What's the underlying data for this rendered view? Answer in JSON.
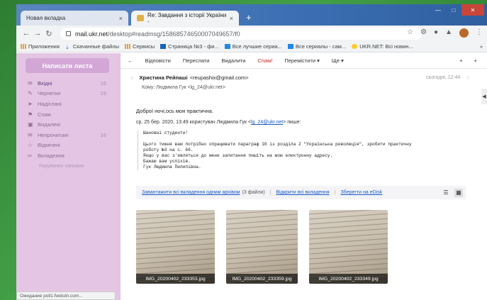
{
  "browser": {
    "tabs": [
      {
        "title": "Новая вкладка",
        "close": "×"
      },
      {
        "title": "Re: Завдання з історії України -",
        "close": "×"
      }
    ],
    "new_tab": "+",
    "url_host": "mail.ukr.net",
    "url_path": "/desktop#readmsg/15868574650007049657/f0",
    "bookmarks": [
      "Приложения",
      "Скачанные файлы",
      "Сервисы",
      "Страница №3 - фи...",
      "Все лучшие сериа...",
      "Все сериалы - сам...",
      "UKR.NET: Всі новин..."
    ],
    "bookmarks_more": "»",
    "status": "Ожидание poll1.fwdcdn.com..."
  },
  "sidebar": {
    "compose": "Написати листа",
    "folders": [
      {
        "label": "Вхідні",
        "count": "16",
        "icon": "inbox-icon"
      },
      {
        "label": "Чернетки",
        "count": "15",
        "icon": "drafts-icon"
      },
      {
        "label": "Надіслані",
        "count": "",
        "icon": "sent-icon"
      },
      {
        "label": "Спам",
        "count": "",
        "icon": "spam-icon"
      },
      {
        "label": "Видалені",
        "count": "",
        "icon": "trash-icon"
      },
      {
        "label": "Непрочитані",
        "count": "16",
        "icon": "unread-icon"
      },
      {
        "label": "Відмічені",
        "count": "",
        "icon": "star-icon"
      },
      {
        "label": "Вкладення",
        "count": "",
        "icon": "attachment-icon"
      }
    ],
    "manage": "Керування папками"
  },
  "toolbar": {
    "back": "←",
    "reply": "Відповісти",
    "forward": "Переслати",
    "delete": "Видалити",
    "spam": "Спам!",
    "move": "Перемістити ▾",
    "more": "Ще ▾",
    "plus1": "+",
    "plus2": "+"
  },
  "message": {
    "sender": "Христина Рейпаші",
    "sender_email": "<reupashix@gmail.com>",
    "date": "сьогодні, 12:44",
    "to_label": "Кому:",
    "to": "Людмила Гук <lg_24@ukr.net>",
    "greeting": "Доброї ночі,ось моя практична.",
    "quote_intro": "ср, 25 бер. 2020, 13:49 користувач Людмила Гук <",
    "quote_email": "lg_24@ukr.net",
    "quote_intro_end": "> пише:",
    "quote_lines": [
      "Шановні студенти!",
      "",
      "Цього тижня вам потрібно опрацювати параграф 10 із розділа 2 \"Українська революція\", зробити практичну",
      "роботу №3 на с. 66.",
      "Якщо у вас з'являться до мене запитання пишіть на мою електронну адресу.",
      "Бажаю вам успіхів.",
      "Гук Людмила Пилипівна."
    ]
  },
  "attachments": {
    "download_all": "Завантажити всі вкладення одним архівом",
    "files_count": "(3 файли)",
    "open_all": "Відкрити всі вкладення",
    "save_edisk": "Зберегти на eDisk",
    "files": [
      "IMG_20200402_233353.jpg",
      "IMG_20200402_233359.jpg",
      "IMG_20200402_233349.jpg"
    ]
  }
}
